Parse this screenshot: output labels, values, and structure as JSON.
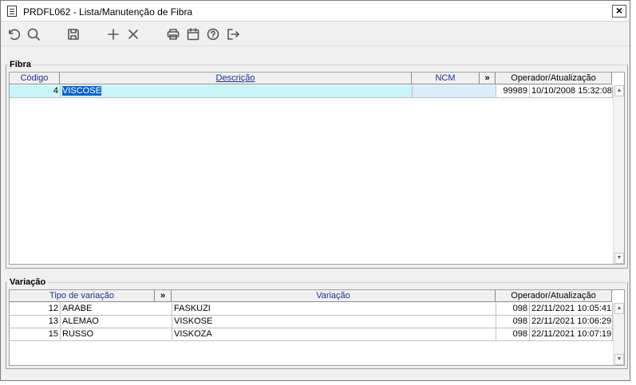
{
  "window": {
    "title": "PRDFL062 - Lista/Manutenção de Fibra",
    "close_label": "×"
  },
  "toolbar": {
    "icons": [
      "undo-icon",
      "search-icon",
      "save-icon",
      "add-icon",
      "delete-icon",
      "print-icon",
      "calendar-icon",
      "help-icon",
      "exit-icon"
    ]
  },
  "fibra": {
    "legend": "Fibra",
    "headers": {
      "codigo": "Código",
      "descricao": "Descrição",
      "ncm": "NCM",
      "chevron": "»",
      "operador": "Operador/Atualização"
    },
    "rows": [
      {
        "codigo": "4",
        "descricao": "VISCOSE",
        "ncm": "",
        "operador": "99989",
        "atualizacao": "10/10/2008 15:32:08"
      }
    ]
  },
  "variacao": {
    "legend": "Variação",
    "headers": {
      "tipo": "Tipo de variação",
      "chevron": "»",
      "variacao": "Variação",
      "operador": "Operador/Atualização"
    },
    "rows": [
      {
        "codigo": "12",
        "tipo": "ARABE",
        "variacao": "FASKUZI",
        "operador": "098",
        "atualizacao": "22/11/2021 10:05:41"
      },
      {
        "codigo": "13",
        "tipo": "ALEMAO",
        "variacao": "VISKOSE",
        "operador": "098",
        "atualizacao": "22/11/2021 10:06:29"
      },
      {
        "codigo": "15",
        "tipo": "RUSSO",
        "variacao": "VISKOZA",
        "operador": "098",
        "atualizacao": "22/11/2021 10:07:19"
      }
    ]
  },
  "scroll": {
    "up": "▲",
    "down": "▼"
  }
}
